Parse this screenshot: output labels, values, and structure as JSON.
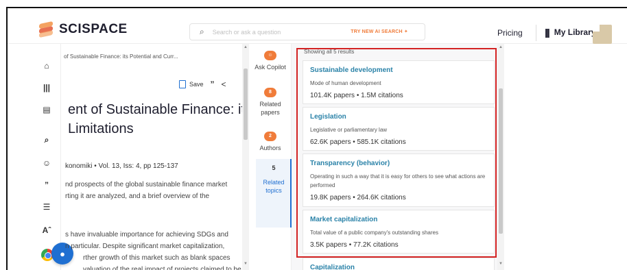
{
  "header": {
    "brand": "SCISPACE",
    "search_placeholder": "Search or ask a question",
    "try_ai": "TRY NEW AI SEARCH ✦",
    "pricing": "Pricing",
    "my_library": "My Library",
    "library_icon": "library-books-icon",
    "search_icon": "search-icon"
  },
  "rail": [
    "home-icon",
    "library-icon",
    "notes-icon",
    "search-icon",
    "chat-icon",
    "quote-icon",
    "list-icon",
    "translate-icon"
  ],
  "paper": {
    "breadcrumb": "of Sustainable Finance: its Potential and Curr...",
    "save_label": "Save",
    "title_line1": "ent of Sustainable Finance: its",
    "title_line2": "Limitations",
    "meta": "konomiki • Vol. 13, Iss: 4, pp 125-137",
    "abstract_l1": "nd prospects of the global sustainable finance market",
    "abstract_l2": "rting it are analyzed, and a brief overview of the",
    "abstract_l3": "s have invaluable importance for achieving SDGs and",
    "abstract_l4": "n particular. Despite significant market capitalization,",
    "abstract_l5": "rther growth of this market such as blank spaces",
    "abstract_l6": "valuation of the real impact of projects claimed to be"
  },
  "copilot": {
    "ask_copilot": "Ask Copilot",
    "related_papers_count": "8",
    "related_papers": "Related papers",
    "authors_count": "2",
    "authors": "Authors",
    "related_topics_count": "5",
    "related_topics": "Related topics"
  },
  "results": {
    "count_text": "Showing all 5 results",
    "items": [
      {
        "title": "Sustainable development",
        "desc": "Mode of human development",
        "stats": "101.4K papers • 1.5M citations"
      },
      {
        "title": "Legislation",
        "desc": "Legislative or parliamentary law",
        "stats": "62.6K papers • 585.1K citations"
      },
      {
        "title": "Transparency (behavior)",
        "desc": "Operating in such a way that it is easy for others to see what actions are performed",
        "stats": "19.8K papers • 264.6K citations"
      },
      {
        "title": "Market capitalization",
        "desc": "Total value of a public company's outstanding shares",
        "stats": "3.5K papers • 77.2K citations"
      },
      {
        "title": "Capitalization",
        "desc": "",
        "stats": ""
      }
    ]
  },
  "colors": {
    "accent_orange": "#f07c3a",
    "link_blue": "#2a82a8",
    "highlight_red": "#d32222",
    "fab_blue": "#1f6fd1"
  }
}
